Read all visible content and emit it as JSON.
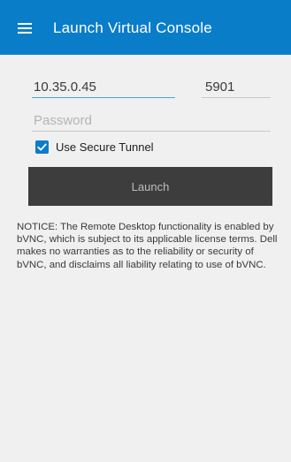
{
  "app_bar": {
    "title": "Launch Virtual Console",
    "menu_icon": "hamburger-menu-icon"
  },
  "form": {
    "host_value": "10.35.0.45",
    "port_value": "5901",
    "password_placeholder": "Password",
    "secure_tunnel_label": "Use Secure Tunnel",
    "secure_tunnel_checked": true,
    "launch_label": "Launch"
  },
  "notice": "NOTICE: The Remote Desktop functionality is enabled by bVNC, which is subject to its applicable license terms. Dell makes no warranties as to the reliability or security of bVNC, and disclaims all liability relating to use of bVNC.",
  "colors": {
    "app_bar": "#0a7dc9",
    "accent": "#0a7dc9",
    "launch_button": "#3d3d3d",
    "background": "#f0f0f0"
  }
}
